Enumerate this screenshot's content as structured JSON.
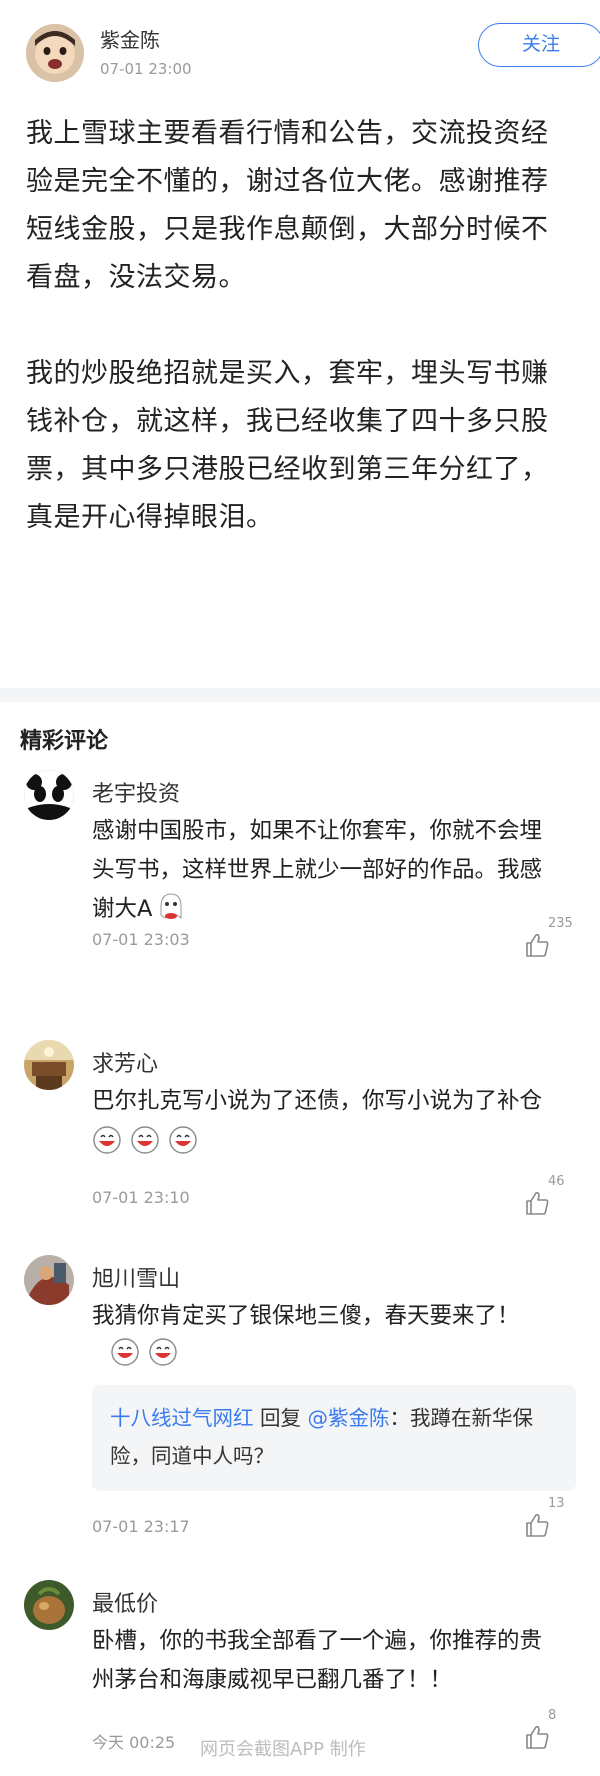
{
  "post": {
    "author": "紫金陈",
    "time": "07-01 23:00",
    "follow_label": "关注",
    "paragraphs": [
      "我上雪球主要看看行情和公告，交流投资经验是完全不懂的，谢过各位大佬。感谢推荐短线金股，只是我作息颠倒，大部分时候不看盘，没法交易。",
      "我的炒股绝招就是买入，套牢，埋头写书赚钱补仓，就这样，我已经收集了四十多只股票，其中多只港股已经收到第三年分红了，真是开心得掉眼泪。"
    ]
  },
  "comments_section": {
    "title": "精彩评论",
    "comments": [
      {
        "name": "老宇投资",
        "text": "感谢中国股市，如果不让你套牢，你就不会埋头写书，这样世界上就少一部好的作品。我感谢大A",
        "time": "07-01 23:03",
        "likes": "235"
      },
      {
        "name": "求芳心",
        "text": "巴尔扎克写小说为了还债，你写小说为了补仓",
        "time": "07-01 23:10",
        "likes": "46"
      },
      {
        "name": "旭川雪山",
        "text": "我猜你肯定买了银保地三傻，春天要来了！",
        "reply": {
          "from": "十八线过气网红",
          "verb": " 回复 ",
          "to": "@紫金陈",
          "text": "：我蹲在新华保险，同道中人吗？"
        },
        "time": "07-01 23:17",
        "likes": "13"
      },
      {
        "name": "最低价",
        "text": "卧槽，你的书我全部看了一个遍，你推荐的贵州茅台和海康威视早已翻几番了！！",
        "time": "今天 00:25",
        "likes": "8"
      }
    ]
  },
  "watermark": "网页会截图APP 制作",
  "colors": {
    "accent": "#3b7bf0",
    "muted": "#9a9a9a",
    "divider": "#f4f5f7"
  }
}
